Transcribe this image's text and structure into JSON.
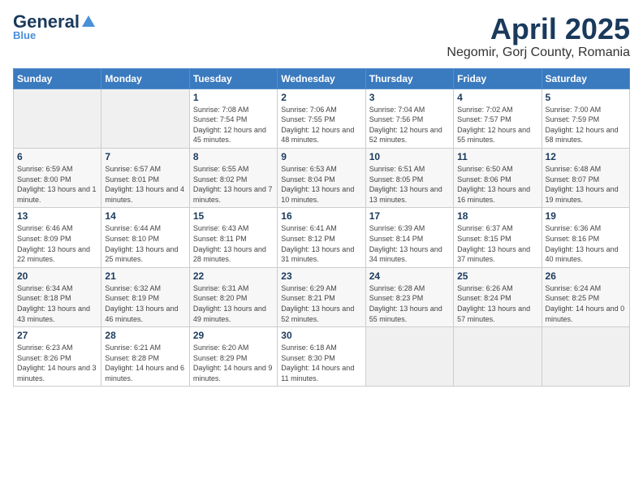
{
  "logo": {
    "part1": "General",
    "part2": "Blue"
  },
  "header": {
    "title": "April 2025",
    "subtitle": "Negomir, Gorj County, Romania"
  },
  "weekdays": [
    "Sunday",
    "Monday",
    "Tuesday",
    "Wednesday",
    "Thursday",
    "Friday",
    "Saturday"
  ],
  "weeks": [
    [
      {
        "day": "",
        "info": ""
      },
      {
        "day": "",
        "info": ""
      },
      {
        "day": "1",
        "info": "Sunrise: 7:08 AM\nSunset: 7:54 PM\nDaylight: 12 hours and 45 minutes."
      },
      {
        "day": "2",
        "info": "Sunrise: 7:06 AM\nSunset: 7:55 PM\nDaylight: 12 hours and 48 minutes."
      },
      {
        "day": "3",
        "info": "Sunrise: 7:04 AM\nSunset: 7:56 PM\nDaylight: 12 hours and 52 minutes."
      },
      {
        "day": "4",
        "info": "Sunrise: 7:02 AM\nSunset: 7:57 PM\nDaylight: 12 hours and 55 minutes."
      },
      {
        "day": "5",
        "info": "Sunrise: 7:00 AM\nSunset: 7:59 PM\nDaylight: 12 hours and 58 minutes."
      }
    ],
    [
      {
        "day": "6",
        "info": "Sunrise: 6:59 AM\nSunset: 8:00 PM\nDaylight: 13 hours and 1 minute."
      },
      {
        "day": "7",
        "info": "Sunrise: 6:57 AM\nSunset: 8:01 PM\nDaylight: 13 hours and 4 minutes."
      },
      {
        "day": "8",
        "info": "Sunrise: 6:55 AM\nSunset: 8:02 PM\nDaylight: 13 hours and 7 minutes."
      },
      {
        "day": "9",
        "info": "Sunrise: 6:53 AM\nSunset: 8:04 PM\nDaylight: 13 hours and 10 minutes."
      },
      {
        "day": "10",
        "info": "Sunrise: 6:51 AM\nSunset: 8:05 PM\nDaylight: 13 hours and 13 minutes."
      },
      {
        "day": "11",
        "info": "Sunrise: 6:50 AM\nSunset: 8:06 PM\nDaylight: 13 hours and 16 minutes."
      },
      {
        "day": "12",
        "info": "Sunrise: 6:48 AM\nSunset: 8:07 PM\nDaylight: 13 hours and 19 minutes."
      }
    ],
    [
      {
        "day": "13",
        "info": "Sunrise: 6:46 AM\nSunset: 8:09 PM\nDaylight: 13 hours and 22 minutes."
      },
      {
        "day": "14",
        "info": "Sunrise: 6:44 AM\nSunset: 8:10 PM\nDaylight: 13 hours and 25 minutes."
      },
      {
        "day": "15",
        "info": "Sunrise: 6:43 AM\nSunset: 8:11 PM\nDaylight: 13 hours and 28 minutes."
      },
      {
        "day": "16",
        "info": "Sunrise: 6:41 AM\nSunset: 8:12 PM\nDaylight: 13 hours and 31 minutes."
      },
      {
        "day": "17",
        "info": "Sunrise: 6:39 AM\nSunset: 8:14 PM\nDaylight: 13 hours and 34 minutes."
      },
      {
        "day": "18",
        "info": "Sunrise: 6:37 AM\nSunset: 8:15 PM\nDaylight: 13 hours and 37 minutes."
      },
      {
        "day": "19",
        "info": "Sunrise: 6:36 AM\nSunset: 8:16 PM\nDaylight: 13 hours and 40 minutes."
      }
    ],
    [
      {
        "day": "20",
        "info": "Sunrise: 6:34 AM\nSunset: 8:18 PM\nDaylight: 13 hours and 43 minutes."
      },
      {
        "day": "21",
        "info": "Sunrise: 6:32 AM\nSunset: 8:19 PM\nDaylight: 13 hours and 46 minutes."
      },
      {
        "day": "22",
        "info": "Sunrise: 6:31 AM\nSunset: 8:20 PM\nDaylight: 13 hours and 49 minutes."
      },
      {
        "day": "23",
        "info": "Sunrise: 6:29 AM\nSunset: 8:21 PM\nDaylight: 13 hours and 52 minutes."
      },
      {
        "day": "24",
        "info": "Sunrise: 6:28 AM\nSunset: 8:23 PM\nDaylight: 13 hours and 55 minutes."
      },
      {
        "day": "25",
        "info": "Sunrise: 6:26 AM\nSunset: 8:24 PM\nDaylight: 13 hours and 57 minutes."
      },
      {
        "day": "26",
        "info": "Sunrise: 6:24 AM\nSunset: 8:25 PM\nDaylight: 14 hours and 0 minutes."
      }
    ],
    [
      {
        "day": "27",
        "info": "Sunrise: 6:23 AM\nSunset: 8:26 PM\nDaylight: 14 hours and 3 minutes."
      },
      {
        "day": "28",
        "info": "Sunrise: 6:21 AM\nSunset: 8:28 PM\nDaylight: 14 hours and 6 minutes."
      },
      {
        "day": "29",
        "info": "Sunrise: 6:20 AM\nSunset: 8:29 PM\nDaylight: 14 hours and 9 minutes."
      },
      {
        "day": "30",
        "info": "Sunrise: 6:18 AM\nSunset: 8:30 PM\nDaylight: 14 hours and 11 minutes."
      },
      {
        "day": "",
        "info": ""
      },
      {
        "day": "",
        "info": ""
      },
      {
        "day": "",
        "info": ""
      }
    ]
  ]
}
